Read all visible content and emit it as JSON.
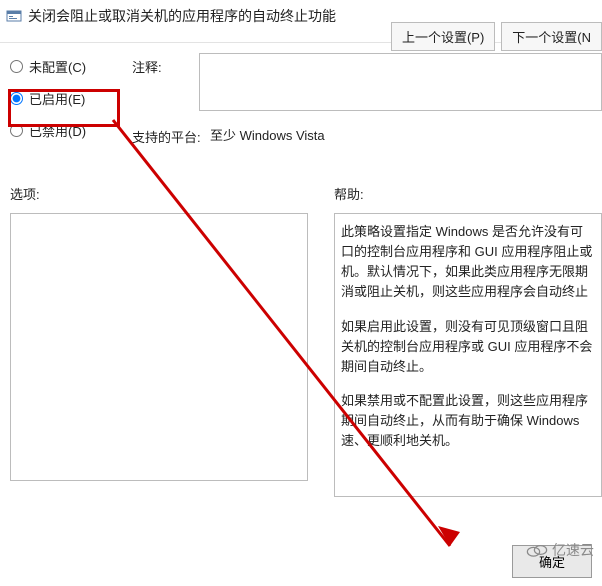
{
  "header": {
    "title": "关闭会阻止或取消关机的应用程序的自动终止功能"
  },
  "nav": {
    "prev": "上一个设置(P)",
    "next": "下一个设置(N"
  },
  "radios": {
    "not_configured": "未配置(C)",
    "enabled": "已启用(E)",
    "disabled": "已禁用(D)"
  },
  "labels": {
    "comment": "注释:",
    "supported": "支持的平台:",
    "options": "选项:",
    "help": "帮助:"
  },
  "values": {
    "supported_on": "至少 Windows Vista"
  },
  "help": {
    "p1": "此策略设置指定 Windows 是否允许没有可口的控制台应用程序和 GUI 应用程序阻止或机。默认情况下，如果此类应用程序无限期消或阻止关机，则这些应用程序会自动终止",
    "p2": "如果启用此设置，则没有可见顶级窗口且阻关机的控制台应用程序或 GUI 应用程序不会期间自动终止。",
    "p3": "如果禁用或不配置此设置，则这些应用程序期间自动终止，从而有助于确保 Windows速、更顺利地关机。"
  },
  "buttons": {
    "ok": "确定"
  },
  "watermark": {
    "text": "亿速云"
  }
}
